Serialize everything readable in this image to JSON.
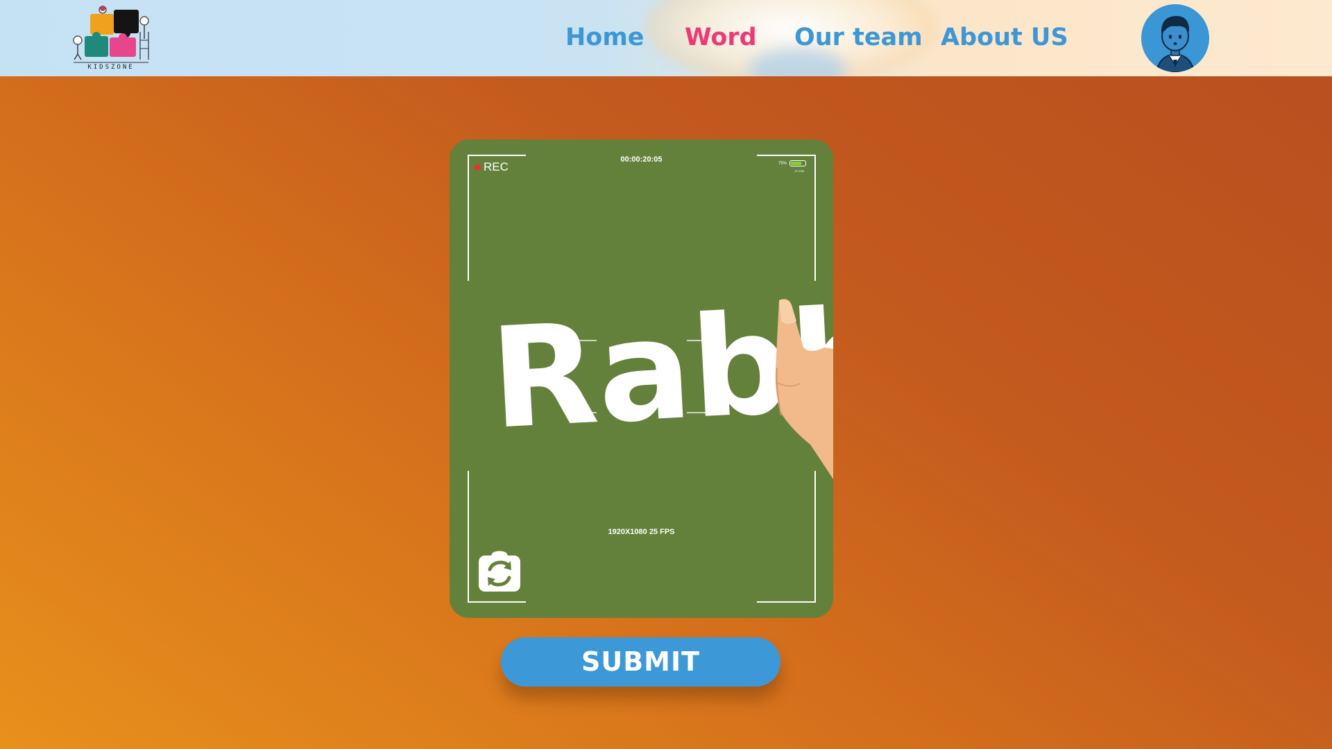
{
  "brand": {
    "logo_text": "KIDSZONE"
  },
  "nav": {
    "items": [
      {
        "label": "Home",
        "active": false
      },
      {
        "label": "Word",
        "active": true
      },
      {
        "label": "Our team",
        "active": false
      },
      {
        "label": "About US",
        "active": false
      }
    ]
  },
  "camera": {
    "rec_label": "REC",
    "timecode": "00:00:20:05",
    "battery_percent": "75%",
    "battery_level": 0.75,
    "battery_sublabel": "1H 20M",
    "resolution_label": "1920X1080 25 FPS",
    "written_word": "Rabbit",
    "switch_icon": "camera-switch-icon"
  },
  "actions": {
    "submit_label": "SUBMIT"
  },
  "colors": {
    "nav_default": "#3d97d6",
    "nav_active": "#ec3a78",
    "camera_bg": "#64813b",
    "submit_bg": "#3d98d8"
  }
}
